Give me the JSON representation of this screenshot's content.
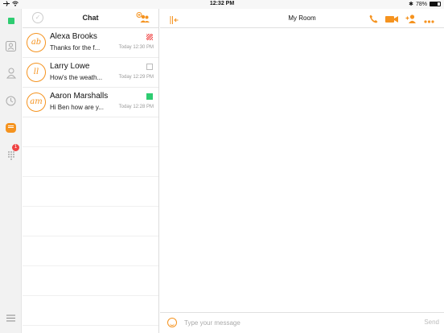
{
  "status_bar": {
    "carrier_icons": "airplane-wifi",
    "time": "12:32 PM",
    "bluetooth": "✱",
    "battery_text": "78%",
    "battery_level": 0.78
  },
  "rail": {
    "accent_color": "#f5931f",
    "presence_color": "#2ecc71",
    "dialpad_badge": "1"
  },
  "chat_list": {
    "title": "Chat",
    "conversations": [
      {
        "initials": "ab",
        "name": "Alexa Brooks",
        "preview": "Thanks for the f...",
        "time": "Today 12:30 PM",
        "status": "striped"
      },
      {
        "initials": "ll",
        "name": "Larry Lowe",
        "preview": "How's the weath...",
        "time": "Today 12:29 PM",
        "status": "empty"
      },
      {
        "initials": "am",
        "name": "Aaron Marshalls",
        "preview": "Hi Ben how are y...",
        "time": "Today 12:28 PM",
        "status": "green"
      }
    ]
  },
  "conversation": {
    "room_name": "My Room"
  },
  "composer": {
    "placeholder": "Type your message",
    "value": "",
    "send_label": "Send"
  }
}
